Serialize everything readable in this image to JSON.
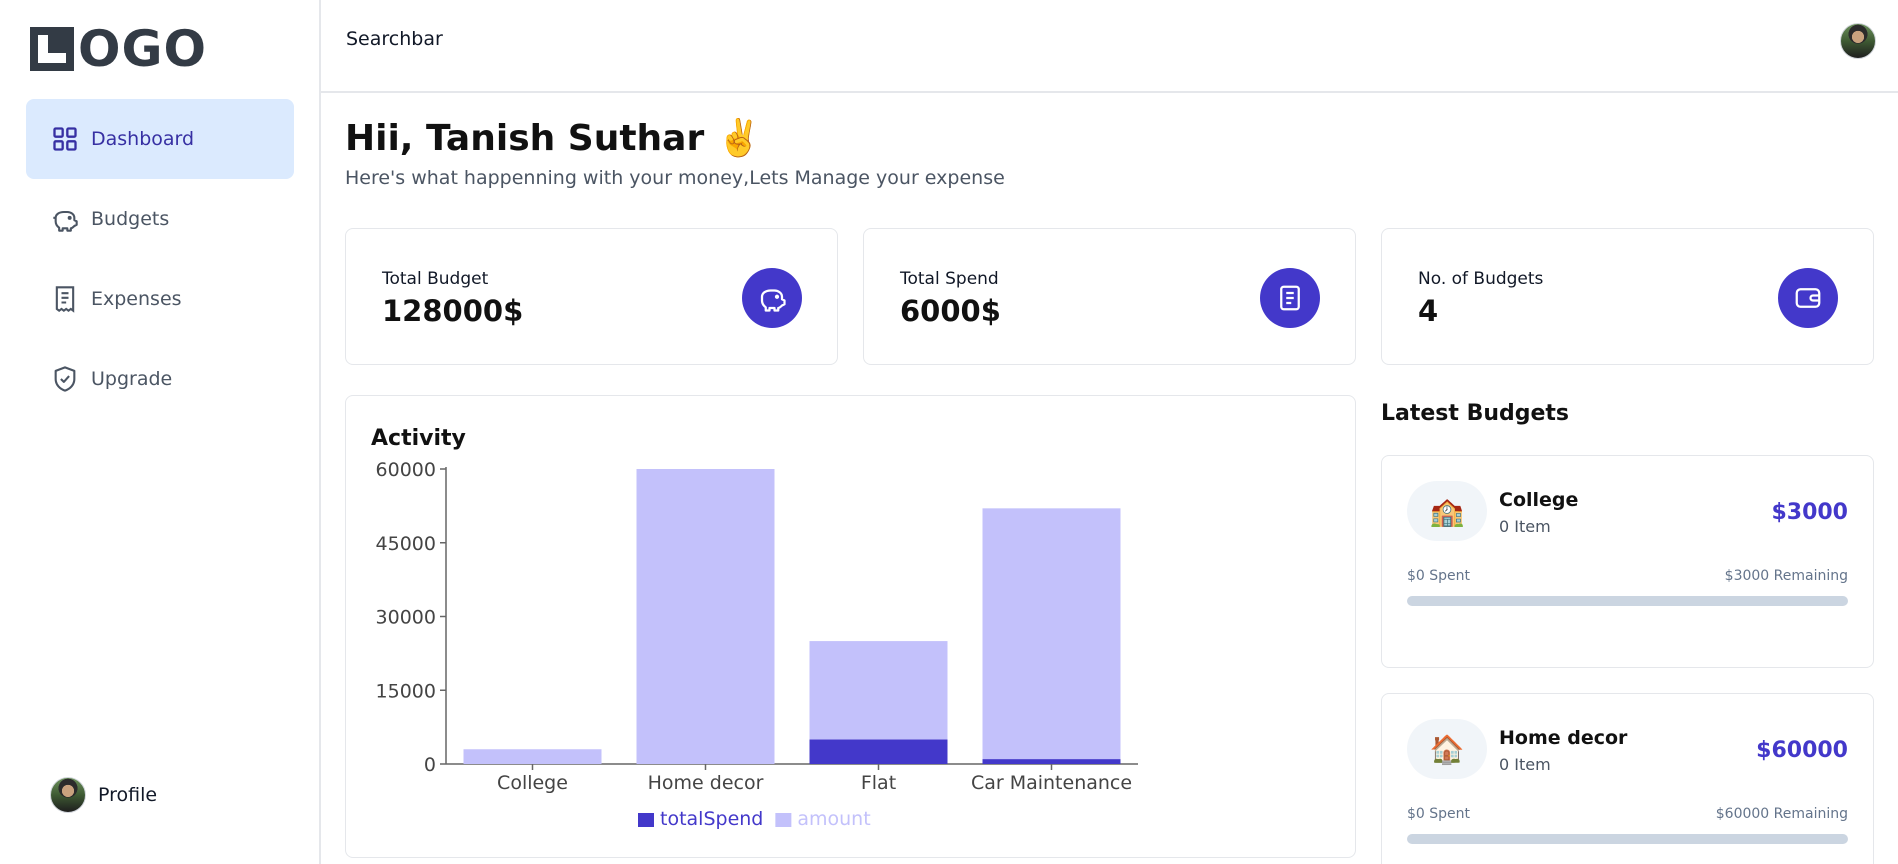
{
  "logo": {
    "text": "OGO"
  },
  "sidebar": {
    "items": [
      {
        "label": "Dashboard",
        "icon": "dashboard-grid-icon",
        "active": true
      },
      {
        "label": "Budgets",
        "icon": "piggy-bank-icon",
        "active": false
      },
      {
        "label": "Expenses",
        "icon": "receipt-icon",
        "active": false
      },
      {
        "label": "Upgrade",
        "icon": "shield-check-icon",
        "active": false
      }
    ],
    "profile_label": "Profile"
  },
  "header": {
    "search_label": "Searchbar"
  },
  "greeting": {
    "title": "Hii, Tanish Suthar ✌️",
    "subtitle": "Here's what happenning with your money,Lets Manage your expense"
  },
  "stats": [
    {
      "label": "Total Budget",
      "value": "128000$",
      "icon": "piggy-bank-icon"
    },
    {
      "label": "Total Spend",
      "value": "6000$",
      "icon": "receipt-icon"
    },
    {
      "label": "No. of Budgets",
      "value": "4",
      "icon": "wallet-icon"
    }
  ],
  "activity": {
    "title": "Activity"
  },
  "chart_data": {
    "type": "bar",
    "stacked": true,
    "categories": [
      "College",
      "Home decor",
      "Flat",
      "Car Maintenance"
    ],
    "series": [
      {
        "name": "totalSpend",
        "values": [
          0,
          0,
          5000,
          1000
        ],
        "color": "#4338ca"
      },
      {
        "name": "amount",
        "values": [
          3000,
          60000,
          20000,
          51000
        ],
        "color": "#c3c1fb"
      }
    ],
    "ylim": [
      0,
      60000
    ],
    "yticks": [
      "60000",
      "45000",
      "30000",
      "15000",
      "0"
    ],
    "yticks_values": [
      60000,
      45000,
      30000,
      15000,
      0
    ],
    "legend": "bottom",
    "grid": false
  },
  "latest": {
    "title": "Latest Budgets",
    "budgets": [
      {
        "emoji": "🏫",
        "name": "College",
        "items": "0 Item",
        "amount": "$3000",
        "spent": "$0 Spent",
        "remaining": "$3000 Remaining",
        "progress": 0
      },
      {
        "emoji": "🏠",
        "name": "Home decor",
        "items": "0 Item",
        "amount": "$60000",
        "spent": "$0 Spent",
        "remaining": "$60000 Remaining",
        "progress": 0
      }
    ]
  },
  "colors": {
    "accent": "#4338ca",
    "accent_light": "#c3c1fb",
    "active_nav_bg": "#dbeafe"
  }
}
